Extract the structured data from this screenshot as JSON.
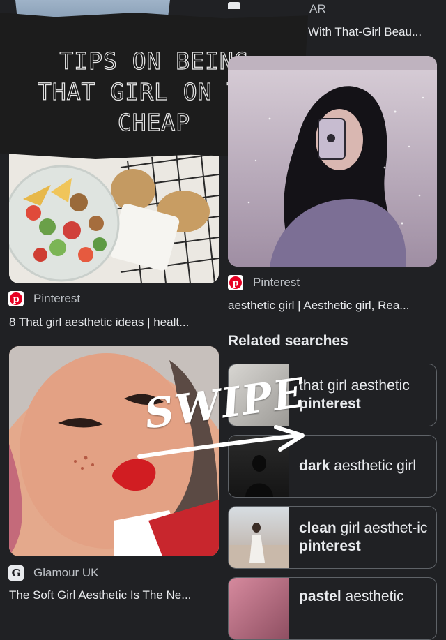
{
  "top": {
    "source_partial": "AR",
    "title_partial": "With That-Girl Beau..."
  },
  "overlay": {
    "lines": [
      "TIPS ON BEING",
      "THAT GIRL ON THE",
      "CHEAP"
    ],
    "swipe": "SWIPE"
  },
  "results": {
    "left1": {
      "source": "Pinterest",
      "title": "8 That girl aesthetic ideas | healt..."
    },
    "right1": {
      "source": "Pinterest",
      "title": "aesthetic girl | Aesthetic girl, Rea..."
    },
    "left2": {
      "source": "Glamour UK",
      "title": "The Soft Girl Aesthetic Is The Ne..."
    }
  },
  "related": {
    "heading": "Related searches",
    "items": [
      {
        "pre": "that girl aesthetic ",
        "bold": "pinterest",
        "post": ""
      },
      {
        "pre": "",
        "bold": "dark",
        "post": " aesthetic girl"
      },
      {
        "pre": "",
        "bold": "clean",
        "post": " girl aesthet-ic ",
        "bold2": "pinterest"
      },
      {
        "pre": "",
        "bold": "pastel",
        "post": " aesthetic"
      }
    ]
  },
  "icons": {
    "pinterest": "pinterest-icon",
    "glamour": "glamour-icon"
  },
  "colors": {
    "background": "#202124",
    "pinterest_red": "#e60023",
    "border": "#5f6368"
  }
}
